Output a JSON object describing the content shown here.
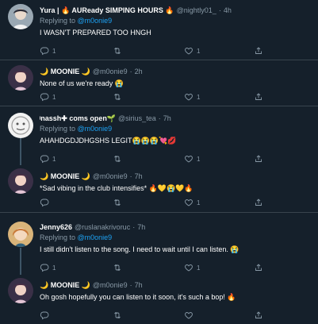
{
  "tweets": [
    {
      "name": "Yura | 🔥 AUReady SIMPING HOURS 🔥",
      "handle": "@nightly01_",
      "dot": "·",
      "time": "4h",
      "reply_prefix": "Replying to ",
      "reply_to": "@m0onie9",
      "text": "I WASN'T PREPARED TOO HNGH",
      "replies": "1",
      "retweets": "",
      "likes": "1"
    },
    {
      "name": "🌙 MOONIE 🌙",
      "handle": "@m0onie9",
      "dot": "·",
      "time": "2h",
      "reply_prefix": "",
      "reply_to": "",
      "text": "None of us we're ready 😭",
      "replies": "1",
      "retweets": "",
      "likes": "1"
    },
    {
      "name": "ᵎnassh✚ coms open🌱",
      "handle": "@sirius_tea",
      "dot": "·",
      "time": "7h",
      "reply_prefix": "Replying to ",
      "reply_to": "@m0onie9",
      "text": "AHAHDGDJDHGSHS LEGIT😭😭😭💘💋",
      "replies": "1",
      "retweets": "",
      "likes": "1"
    },
    {
      "name": "🌙 MOONIE 🌙",
      "handle": "@m0onie9",
      "dot": "·",
      "time": "7h",
      "reply_prefix": "",
      "reply_to": "",
      "text": "*Sad vibing in the club intensifies* 🔥💛😭💛🔥",
      "replies": "",
      "retweets": "",
      "likes": "1"
    },
    {
      "name": "Jenny626",
      "handle": "@ruslanakrivoruc",
      "dot": "·",
      "time": "7h",
      "reply_prefix": "Replying to ",
      "reply_to": "@m0onie9",
      "text": "I still didn't listen to the song. I need to wait until I can listen. 😭",
      "replies": "1",
      "retweets": "",
      "likes": "1"
    },
    {
      "name": "🌙 MOONIE 🌙",
      "handle": "@m0onie9",
      "dot": "·",
      "time": "7h",
      "reply_prefix": "",
      "reply_to": "",
      "text": "Oh gosh hopefully you can listen to it soon, it's such a bop! 🔥",
      "replies": "",
      "retweets": "",
      "likes": ""
    }
  ],
  "icons": {
    "reply": "reply-icon",
    "retweet": "retweet-icon",
    "like": "heart-icon",
    "share": "share-icon"
  },
  "colors": {
    "background": "#15202b",
    "divider": "#38444d",
    "muted": "#8899a6",
    "mention": "#1da1f2"
  }
}
